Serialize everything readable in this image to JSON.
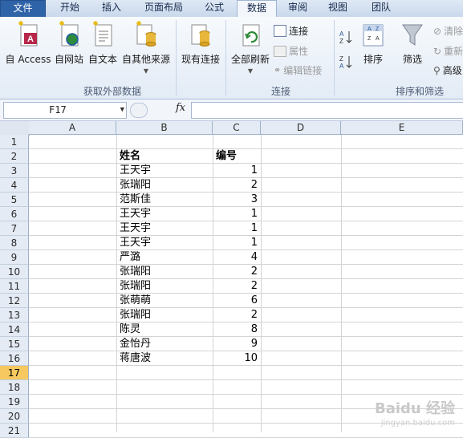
{
  "ribbon_tabs": [
    "文件",
    "开始",
    "插入",
    "页面布局",
    "公式",
    "数据",
    "审阅",
    "视图",
    "团队"
  ],
  "active_tab": "数据",
  "ribbon": {
    "get_external": {
      "access": "自 Access",
      "web": "自网站",
      "text": "自文本",
      "other": "自其他来源",
      "existing": "现有连接",
      "group_label": "获取外部数据"
    },
    "connections": {
      "refresh_all": "全部刷新",
      "connections": "连接",
      "properties": "属性",
      "edit_links": "编辑链接",
      "group_label": "连接"
    },
    "sort_filter": {
      "sort": "排序",
      "filter": "筛选",
      "clear": "清除",
      "reapply": "重新",
      "advanced": "高级",
      "group_label": "排序和筛选"
    }
  },
  "formula_bar": {
    "name_box": "F17",
    "fx": "fx",
    "formula": ""
  },
  "sheet": {
    "columns": [
      "A",
      "B",
      "C",
      "D",
      "E"
    ],
    "rows": [
      "1",
      "2",
      "3",
      "4",
      "5",
      "6",
      "7",
      "8",
      "9",
      "10",
      "11",
      "12",
      "13",
      "14",
      "15",
      "16",
      "17",
      "18",
      "19",
      "20",
      "21"
    ],
    "active_row": "17",
    "header": {
      "name": "姓名",
      "number": "编号"
    },
    "data": [
      {
        "name": "王天宇",
        "number": "1"
      },
      {
        "name": "张瑞阳",
        "number": "2"
      },
      {
        "name": "范斯佳",
        "number": "3"
      },
      {
        "name": "王天宇",
        "number": "1"
      },
      {
        "name": "王天宇",
        "number": "1"
      },
      {
        "name": "王天宇",
        "number": "1"
      },
      {
        "name": "严潞",
        "number": "4"
      },
      {
        "name": "张瑞阳",
        "number": "2"
      },
      {
        "name": "张瑞阳",
        "number": "2"
      },
      {
        "name": "张萌萌",
        "number": "6"
      },
      {
        "name": "张瑞阳",
        "number": "2"
      },
      {
        "name": "陈灵",
        "number": "8"
      },
      {
        "name": "金怡丹",
        "number": "9"
      },
      {
        "name": "蒋唐波",
        "number": "10"
      }
    ]
  },
  "watermark": {
    "brand": "Baidu 经验",
    "url": "jingyan.baidu.com"
  },
  "colors": {
    "file_tab": "#2f63a8",
    "active_row_header": "#f6c85f",
    "grid_line": "#d4d4d4"
  }
}
